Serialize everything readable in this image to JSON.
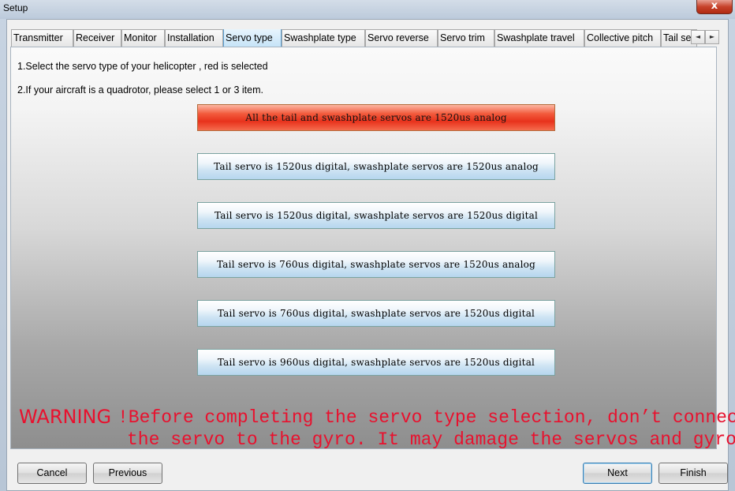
{
  "window": {
    "title": "Setup",
    "close_symbol": "x"
  },
  "tabs": [
    {
      "label": "Transmitter"
    },
    {
      "label": "Receiver"
    },
    {
      "label": "Monitor"
    },
    {
      "label": "Installation"
    },
    {
      "label": "Servo type",
      "active": true
    },
    {
      "label": "Swashplate type"
    },
    {
      "label": "Servo reverse"
    },
    {
      "label": "Servo trim"
    },
    {
      "label": "Swashplate travel"
    },
    {
      "label": "Collective pitch"
    },
    {
      "label": "Tail se"
    }
  ],
  "tab_scroll": {
    "left": "◄",
    "right": "►"
  },
  "instructions": {
    "line1": "1.Select the servo type of your helicopter , red is selected",
    "line2": "2.If your aircraft is a quadrotor, please select 1 or 3 item."
  },
  "servo_options": [
    {
      "label": "All the tail and swashplate servos are 1520us analog",
      "selected": true
    },
    {
      "label": "Tail servo is 1520us digital, swashplate servos are 1520us analog",
      "selected": false
    },
    {
      "label": "Tail servo is 1520us digital, swashplate servos are 1520us digital",
      "selected": false
    },
    {
      "label": "Tail servo is 760us digital, swashplate servos are 1520us analog",
      "selected": false
    },
    {
      "label": "Tail servo is 760us digital, swashplate servos are 1520us digital",
      "selected": false
    },
    {
      "label": "Tail servo is 960us digital, swashplate servos are 1520us digital",
      "selected": false
    }
  ],
  "warning": {
    "word": "WARNING",
    "line1": "!Before completing the servo type selection, don’t connect",
    "line2": "the servo to the gyro. It may damage the servos and gyro!"
  },
  "colors": {
    "selected": "#e8321c",
    "warning": "#e8112e",
    "active_tab": "#c5e3f7"
  },
  "buttons": {
    "cancel": "Cancel",
    "previous": "Previous",
    "next": "Next",
    "finish": "Finish"
  }
}
